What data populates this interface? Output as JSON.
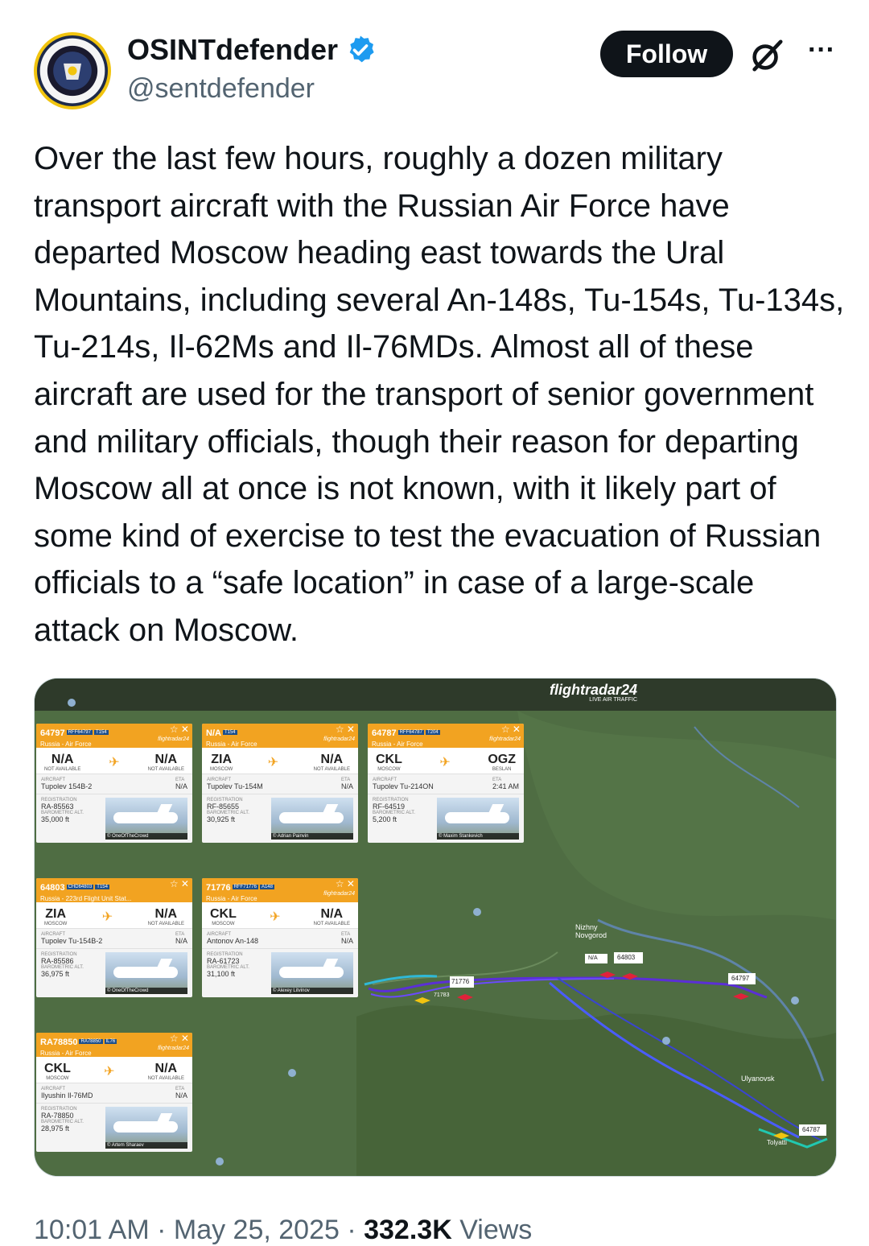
{
  "author": {
    "name": "OSINTdefender",
    "handle": "@sentdefender",
    "verified": true
  },
  "actions": {
    "follow_label": "Follow",
    "grok_icon": "grok-icon",
    "more_icon": "more-icon"
  },
  "tweet": {
    "text": "Over the last few hours, roughly a dozen military transport aircraft with the Russian Air Force have departed Moscow heading east towards the Ural Mountains, including several An-148s, Tu-154s, Tu-134s, Tu-214s, Il-62Ms and Il-76MDs. Almost all of these aircraft are used for the transport of senior government and military officials, though their reason for departing Moscow all at once is not known, with it likely part of some kind of exercise to test the evacuation of Russian officials to a “safe location” in case of a large-scale attack on Moscow."
  },
  "media": {
    "logo": "flightradar24",
    "logo_sub": "LIVE AIR TRAFFIC",
    "cards": [
      {
        "callsign": "64797",
        "tag1": "RFF64797",
        "tag2": "T154",
        "operator": "Russia - Air Force",
        "brand": "flightradar24",
        "from_code": "N/A",
        "from_city": "NOT AVAILABLE",
        "to_code": "N/A",
        "to_city": "NOT AVAILABLE",
        "aircraft_label": "AIRCRAFT",
        "aircraft": "Tupolev 154B-2",
        "eta_label": "ETA",
        "eta": "N/A",
        "reg_label": "REGISTRATION",
        "reg": "RA-85563",
        "alt_label": "BAROMETRIC ALT.",
        "alt": "35,000 ft",
        "credit": "© OneOfTheCrowd"
      },
      {
        "callsign": "N/A",
        "tag1": "T154",
        "tag2": "",
        "operator": "Russia - Air Force",
        "brand": "flightradar24",
        "from_code": "ZIA",
        "from_city": "MOSCOW",
        "to_code": "N/A",
        "to_city": "NOT AVAILABLE",
        "aircraft_label": "AIRCRAFT",
        "aircraft": "Tupolev Tu-154M",
        "eta_label": "ETA",
        "eta": "N/A",
        "reg_label": "REGISTRATION",
        "reg": "RF-85655",
        "alt_label": "BAROMETRIC ALT.",
        "alt": "30,925 ft",
        "credit": "© Adrian Painvin"
      },
      {
        "callsign": "64787",
        "tag1": "RFF64787",
        "tag2": "T204",
        "operator": "Russia - Air Force",
        "brand": "flightradar24",
        "from_code": "CKL",
        "from_city": "MOSCOW",
        "to_code": "OGZ",
        "to_city": "BESLAN",
        "aircraft_label": "AIRCRAFT",
        "aircraft": "Tupolev Tu-214ON",
        "eta_label": "ETA",
        "eta": "2:41 AM",
        "reg_label": "REGISTRATION",
        "reg": "RF-64519",
        "alt_label": "BAROMETRIC ALT.",
        "alt": "5,200 ft",
        "credit": "© Maxim Stankevich"
      },
      {
        "callsign": "64803",
        "tag1": "CHD64803",
        "tag2": "T154",
        "operator": "Russia - 223rd Flight Unit Stat...",
        "brand": "flightradar24",
        "from_code": "ZIA",
        "from_city": "MOSCOW",
        "to_code": "N/A",
        "to_city": "NOT AVAILABLE",
        "aircraft_label": "AIRCRAFT",
        "aircraft": "Tupolev Tu-154B-2",
        "eta_label": "ETA",
        "eta": "N/A",
        "reg_label": "REGISTRATION",
        "reg": "RA-85586",
        "alt_label": "BAROMETRIC ALT.",
        "alt": "36,975 ft",
        "credit": "© OneOfTheCrowd"
      },
      {
        "callsign": "71776",
        "tag1": "RFF71776",
        "tag2": "A148",
        "operator": "Russia - Air Force",
        "brand": "flightradar24",
        "from_code": "CKL",
        "from_city": "MOSCOW",
        "to_code": "N/A",
        "to_city": "NOT AVAILABLE",
        "aircraft_label": "AIRCRAFT",
        "aircraft": "Antonov An-148",
        "eta_label": "ETA",
        "eta": "N/A",
        "reg_label": "REGISTRATION",
        "reg": "RA-61723",
        "alt_label": "BAROMETRIC ALT.",
        "alt": "31,100 ft",
        "credit": "© Alexey Litvinov"
      },
      {
        "callsign": "RA78850",
        "tag1": "RA78850",
        "tag2": "IL76",
        "operator": "Russia - Air Force",
        "brand": "flightradar24",
        "from_code": "CKL",
        "from_city": "MOSCOW",
        "to_code": "N/A",
        "to_city": "NOT AVAILABLE",
        "aircraft_label": "AIRCRAFT",
        "aircraft": "Ilyushin Il-76MD",
        "eta_label": "ETA",
        "eta": "N/A",
        "reg_label": "REGISTRATION",
        "reg": "RA-78850",
        "alt_label": "BAROMETRIC ALT.",
        "alt": "28,975 ft",
        "credit": "© Artem Sharaev"
      }
    ],
    "map_labels": {
      "nizhny": "Nizhny Novgorod",
      "ulyanovsk": "Ulyanovsk",
      "tolyatti": "Tolyatti",
      "label_64803": "64803",
      "label_64797": "64797",
      "label_71776": "71776",
      "label_71783": "71783",
      "label_64787": "64787",
      "label_na": "N/A"
    }
  },
  "footer": {
    "time": "10:01 AM · May 25, 2025 · ",
    "views_count": "332.3K",
    "views_label": " Views"
  }
}
